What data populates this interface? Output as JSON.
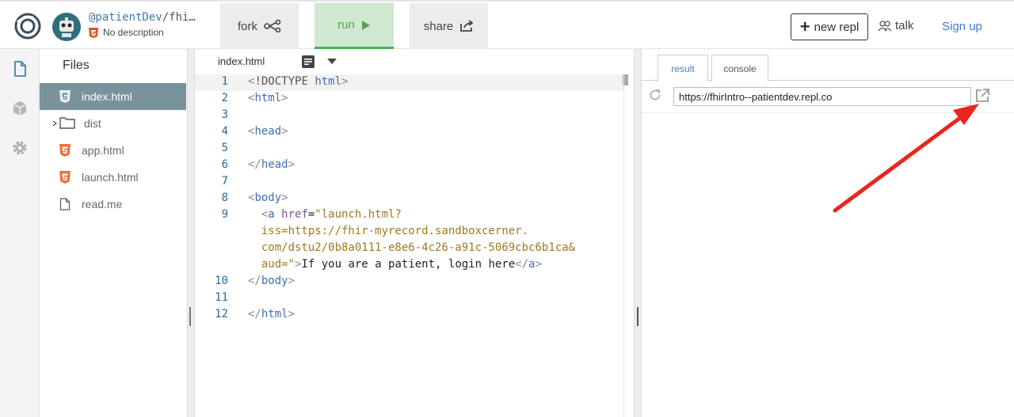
{
  "header": {
    "repl_owner": "@patientDev",
    "repl_slug": "/fhi…",
    "description": "No description",
    "buttons": {
      "fork": "fork",
      "run": "run",
      "share": "share",
      "new_repl": "new repl",
      "talk": "talk",
      "sign_up": "Sign up"
    }
  },
  "sidebar": {
    "rail_icons": [
      "file-icon",
      "package-icon",
      "settings-gear-icon"
    ]
  },
  "files": {
    "title": "Files",
    "items": [
      {
        "label": "index.html",
        "icon": "html5-icon",
        "active": true
      },
      {
        "label": "dist",
        "icon": "folder-icon",
        "active": false
      },
      {
        "label": "app.html",
        "icon": "html5-icon",
        "active": false
      },
      {
        "label": "launch.html",
        "icon": "html5-icon",
        "active": false
      },
      {
        "label": "read.me",
        "icon": "document-icon",
        "active": false
      }
    ]
  },
  "editor": {
    "tab": "index.html",
    "line_numbers": [
      "1",
      "2",
      "3",
      "4",
      "5",
      "6",
      "7",
      "8",
      "9",
      "10",
      "11",
      "12"
    ],
    "lines": [
      "<!DOCTYPE html>",
      "<html>",
      "",
      "<head>",
      "",
      "</head>",
      "",
      "<body>",
      "  <a href=\"launch.html?",
      "  iss=https://fhir-myrecord.sandboxcerner.",
      "  com/dstu2/0b8a0111-e8e6-4c26-a91c-5069cbc6b1ca&",
      "  aud=\">If you are a patient, login here</a>",
      "</body>",
      "",
      "</html>"
    ]
  },
  "result": {
    "tabs": [
      "result",
      "console"
    ],
    "active_tab": "result",
    "url": "https://fhirIntro--patientdev.repl.co"
  },
  "colors": {
    "active_file_bg": "#79939c",
    "run_green": "#4caf50",
    "link_blue": "#3d7ec8",
    "annotation_red": "#e8261c"
  }
}
